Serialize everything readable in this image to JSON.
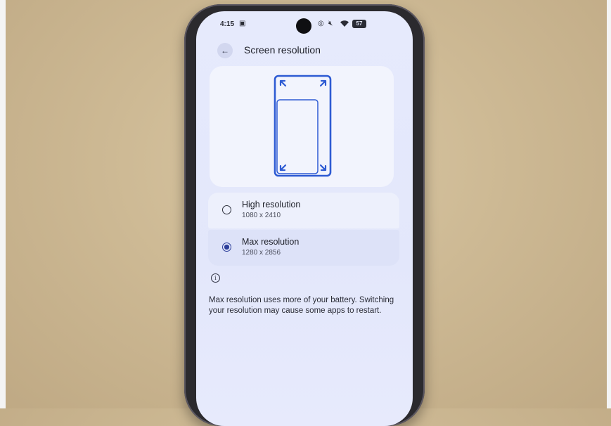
{
  "status_bar": {
    "time": "4:15",
    "notification_icon": "screen-record-icon",
    "icons": [
      "alarm-icon",
      "mute-icon",
      "wifi-icon"
    ],
    "battery": "57"
  },
  "header": {
    "back_icon": "←",
    "title": "Screen resolution"
  },
  "options": [
    {
      "title": "High resolution",
      "subtitle": "1080 x 2410",
      "selected": false
    },
    {
      "title": "Max resolution",
      "subtitle": "1280 x 2856",
      "selected": true
    }
  ],
  "info": {
    "icon": "i",
    "text": "Max resolution uses more of your battery. Switching your resolution may cause some apps to restart."
  },
  "colors": {
    "accent": "#2c3e9a",
    "illustration": "#2e5bd3",
    "screen_bg": "#e4e8fb"
  }
}
